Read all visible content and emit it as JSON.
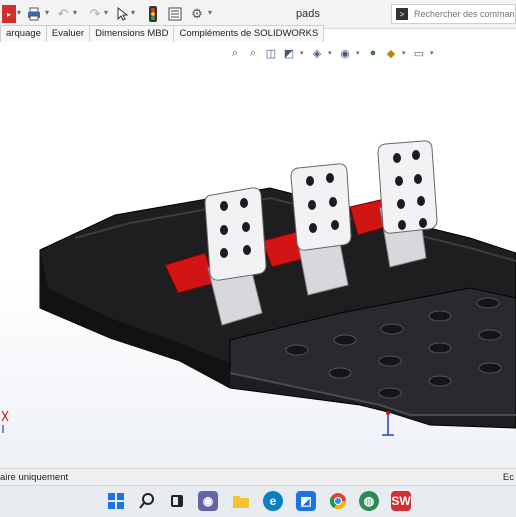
{
  "window": {
    "title": "pads"
  },
  "toolbar": {
    "icons": [
      "solidworks-menu-icon",
      "new-file-icon",
      "print-icon",
      "undo-icon",
      "redo-icon",
      "select-arrow-icon",
      "traffic-light-icon",
      "file-properties-icon",
      "options-gear-icon"
    ]
  },
  "search": {
    "placeholder": "Rechercher des commandes"
  },
  "tabs": [
    {
      "label": "arquage"
    },
    {
      "label": "Evaluer"
    },
    {
      "label": "Dimensions MBD"
    },
    {
      "label": "Compléments de SOLIDWORKS"
    }
  ],
  "heads_up": {
    "icons": [
      "zoom-to-fit-icon",
      "zoom-area-icon",
      "previous-view-icon",
      "section-view-icon",
      "view-orientation-icon",
      "display-style-icon",
      "hide-show-icon",
      "appearance-icon",
      "scene-icon",
      "monitor-icon"
    ]
  },
  "statusbar": {
    "left": "aire uniquement",
    "right": "Ec"
  },
  "taskbar": {
    "icons": [
      "windows-start-icon",
      "search-icon",
      "task-view-icon",
      "teams-chat-icon",
      "file-explorer-icon",
      "edge-icon",
      "store-icon",
      "chrome-icon",
      "maps-icon",
      "solidworks-icon"
    ]
  },
  "colors": {
    "pad": "#f2f2f4",
    "base": "#1c1c1e",
    "accent_red": "#d11414"
  }
}
